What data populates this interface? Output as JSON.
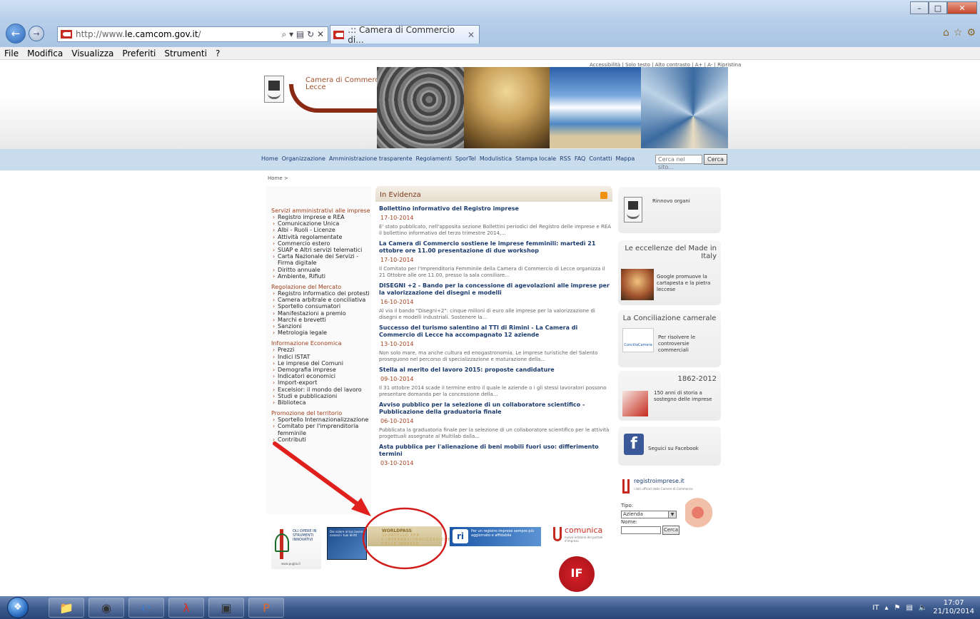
{
  "browser": {
    "url_prefix": "http://www.",
    "url_domain": "le.camcom.gov.it",
    "url_suffix": "/",
    "tab_title": ".:: Camera di Commercio di...",
    "addr_tools": "⌕ ▾ ▤ ↻ ✕",
    "menu": [
      "File",
      "Modifica",
      "Visualizza",
      "Preferiti",
      "Strumenti",
      "?"
    ]
  },
  "site": {
    "accessibility": "Accessibilità | Solo testo | Alto contrasto | A+ | A- | Ripristina",
    "logo_line1": "Camera di Commercio",
    "logo_line2": "Lecce",
    "nav": [
      "Home",
      "Organizzazione",
      "Amministrazione trasparente",
      "Regolamenti",
      "SporTel",
      "Modulistica",
      "Stampa locale",
      "RSS",
      "FAQ",
      "Contatti",
      "Mappa"
    ],
    "search_placeholder": "Cerca nel sito...",
    "search_button": "Cerca",
    "breadcrumb": "Home >"
  },
  "left": {
    "sections": [
      {
        "head": "Servizi amministrativi alle imprese",
        "items": [
          "Registro imprese e REA",
          "Comunicazione Unica",
          "Albi - Ruoli - Licenze",
          "Attività regolamentate",
          "Commercio estero",
          "SUAP e Altri servizi telematici",
          "Carta Nazionale dei Servizi - Firma digitale",
          "Diritto annuale",
          "Ambiente, Rifiuti"
        ]
      },
      {
        "head": "Regolazione del Mercato",
        "items": [
          "Registro informatico dei protesti",
          "Camera arbitrale e conciliativa",
          "Sportello consumatori",
          "Manifestazioni a premio",
          "Marchi e brevetti",
          "Sanzioni",
          "Metrologia legale"
        ]
      },
      {
        "head": "Informazione Economica",
        "items": [
          "Prezzi",
          "Indici ISTAT",
          "Le imprese dei Comuni",
          "Demografia imprese",
          "Indicatori economici",
          "Import-export",
          "Excelsior: il mondo del lavoro",
          "Studi e pubblicazioni",
          "Biblioteca"
        ]
      },
      {
        "head": "Promozione del territorio",
        "items": [
          "Sportello Internazionalizzazione",
          "Comitato per l'imprenditoria femminile",
          "Contributi"
        ]
      }
    ]
  },
  "center": {
    "heading": "In Evidenza",
    "news": [
      {
        "title": "Bollettino informativo del Registro imprese",
        "date": "17-10-2014",
        "desc": "E' stato pubblicato, nell'apposita sezione Bollettini periodici del Registro delle imprese e REA il bollettino informativo del terzo trimestre 2014,..."
      },
      {
        "title": "La Camera di Commercio sostiene le imprese femminili: martedì 21 ottobre ore 11.00 presentazione di due workshop",
        "date": "17-10-2014",
        "desc": "Il Comitato per l'Imprenditoria Femminile della Camera di Commercio di Lecce organizza il 21 Ottobre alle ore 11.00, presso la sala consiliare..."
      },
      {
        "title": "DISEGNI +2 - Bando per la concessione di agevolazioni alle imprese per la valorizzazione dei disegni e modelli",
        "date": "16-10-2014",
        "desc": "Al via il bando \"Disegni+2\": cinque milioni di euro alle imprese per la valorizzazione di disegni e modelli industriali. Sostenere la..."
      },
      {
        "title": "Successo del turismo salentino al TTI di Rimini - La Camera di Commercio di Lecce ha accompagnato 12 aziende",
        "date": "13-10-2014",
        "desc": "Non solo mare, ma anche cultura ed enogastronomia. Le imprese turistiche del Salento proseguono nel percorso di specializzazione e maturazione della..."
      },
      {
        "title": "Stella al merito del lavoro 2015: proposte candidature",
        "date": "09-10-2014",
        "desc": "Il 31 ottobre 2014 scade il termine entro il quale le aziende o i gli stessi lavoratori possono presentare domanda per la concessione della..."
      },
      {
        "title": "Avviso pubblico per la selezione di un collaboratore scientifico - Pubblicazione della graduatoria finale",
        "date": "06-10-2014",
        "desc": "Pubblicata la graduatoria finale per la selezione di un collaboratore scientifico per le attività progettuali assegnate al Multilab dalla..."
      },
      {
        "title": "Asta pubblica per l'alienazione di beni mobili fuori uso: differimento termini",
        "date": "03-10-2014",
        "desc": ""
      }
    ]
  },
  "right": {
    "rinnovo": "Rinnovo organi",
    "eccellenze_title": "Le eccellenze del Made in Italy",
    "eccellenze_text": "Google promuove la cartapesta e la pietra leccese",
    "conciliazione_title": "La Conciliazione camerale",
    "conciliazione_text": "Per risolvere le controversie commerciali",
    "conciliazione_logo": "ConciliaCamera",
    "anni_title": "1862-2012",
    "anni_text": "150 anni di storia a sostegno delle imprese",
    "facebook_text": "Seguici su Facebook",
    "registro_title": "registroimprese.it",
    "registro_sub": "i dati ufficiali delle Camere di Commercio",
    "tipo_label": "Tipo:",
    "tipo_value": "Azienda",
    "nome_label": "Nome:",
    "cerca_label": "Cerca"
  },
  "banners": {
    "b1_text": "OLI OPERE IN STRUMENTI INNOVATIVI",
    "b1_url": "www.puglia.it",
    "b2_text": "Dai valore al tuo lavoro, conosci i tuoi diritti",
    "b3_title": "WORLDPASS",
    "b3_sub": "SPORTELLO PER L'INTERNAZIONALIZZAZIONE DELLE IMPRESE",
    "b4_text": "Per un registro imprese sempre più aggiornato e affidabile",
    "b5_word": "comunica",
    "b5_sub": "nuova edizione del portale d'impresa",
    "b6_text": "IF"
  },
  "taskbar": {
    "lang": "IT",
    "time": "17:07",
    "date": "21/10/2014"
  },
  "colors": {
    "accent_red": "#c62a1e",
    "nav_band": "#c9dcee",
    "link_blue": "#1a3a6e",
    "heading_brown": "#a0401c"
  }
}
